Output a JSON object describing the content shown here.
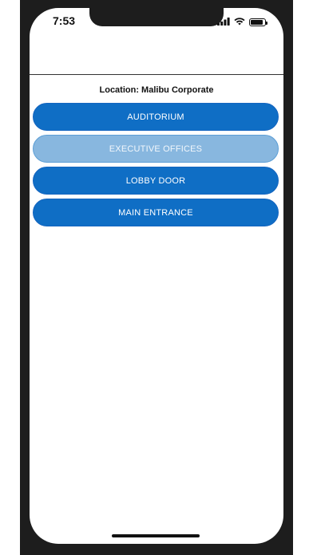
{
  "status_bar": {
    "time": "7:53",
    "icons": [
      "signal-icon",
      "wifi-icon",
      "battery-icon"
    ]
  },
  "location": {
    "label": "Location: Malibu Corporate"
  },
  "doors": [
    {
      "label": "AUDITORIUM",
      "state": "enabled"
    },
    {
      "label": "EXECUTIVE OFFICES",
      "state": "disabled"
    },
    {
      "label": "LOBBY DOOR",
      "state": "enabled"
    },
    {
      "label": "MAIN ENTRANCE",
      "state": "enabled"
    }
  ],
  "colors": {
    "accent": "#0f6ec5",
    "accent_disabled": "#88b7df",
    "device_frame": "#1d1d1d"
  }
}
